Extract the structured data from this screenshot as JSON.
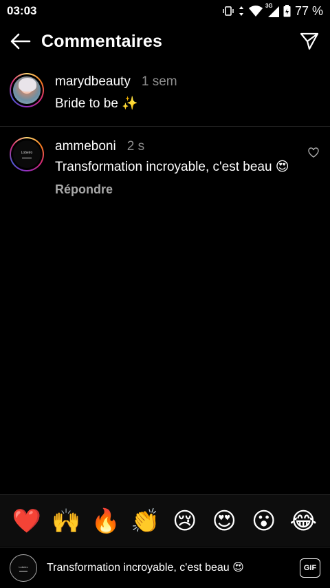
{
  "status_bar": {
    "time": "03:03",
    "network": "3G",
    "battery": "77 %",
    "icons": [
      "vibrate-icon",
      "data-arrows-icon",
      "wifi-icon",
      "signal-icon",
      "battery-icon"
    ]
  },
  "header": {
    "title": "Commentaires",
    "back_icon": "back-arrow-icon",
    "send_icon": "send-icon"
  },
  "caption": {
    "username": "marydbeauty",
    "time": "1 sem",
    "text": "Bride to be ✨"
  },
  "comments": [
    {
      "username": "ammeboni",
      "time": "2 s",
      "text": "Transformation incroyable, c'est beau 😍",
      "reply_label": "Répondre"
    }
  ],
  "avatar_text": "Lobeiro",
  "emoji_bar": [
    "❤️",
    "🙌",
    "🔥",
    "👏",
    "😢",
    "😍",
    "😮",
    "😂"
  ],
  "composer": {
    "value": "Transformation incroyable, c'est beau 😍",
    "gif_label": "GIF"
  },
  "colors": {
    "background": "#000000",
    "muted_text": "#8e8e8e",
    "divider": "#262626"
  }
}
